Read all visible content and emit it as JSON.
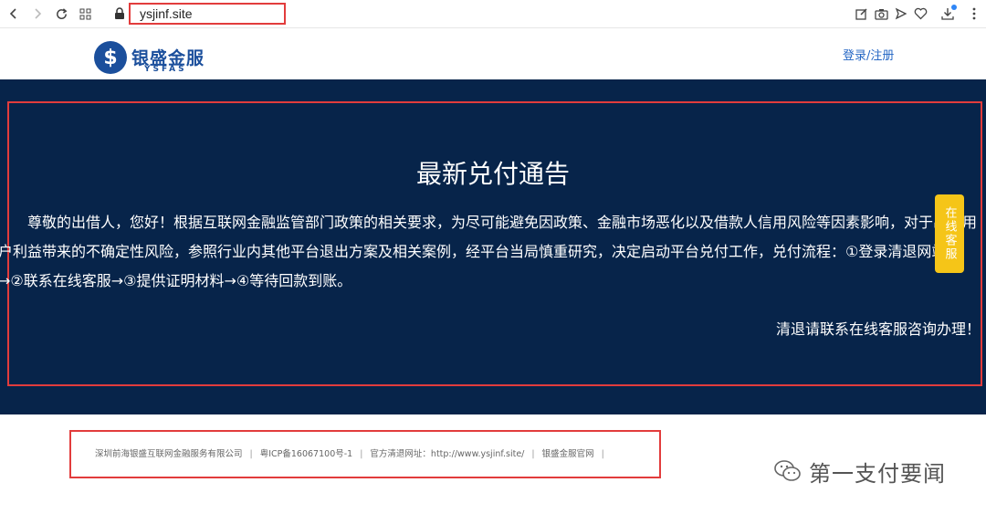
{
  "browser": {
    "url": "ysjinf.site"
  },
  "site": {
    "logo_cn": "银盛金服",
    "logo_en": "YSFAS",
    "login_label": "登录/注册"
  },
  "notice": {
    "title": "最新兑付通告",
    "lines": [
      "　　尊敬的出借人，您好！根据互联网金融监管部门政策的相关要求，为尽可能避免因政策、金融市场恶化以及借款人信用风险等因素影响，对于出借用",
      "户利益带来的不确定性风险，参照行业内其他平台退出方案及相关案例，经平台当局慎重研究，决定启动平台兑付工作，兑付流程：①登录清退网站",
      "→②联系在线客服→③提供证明材料→④等待回款到账。"
    ],
    "closing": "清退请联系在线客服咨询办理！",
    "cs_tab": "在线客服"
  },
  "footer": {
    "company": "深圳前海银盛互联网金融服务有限公司",
    "icp": "粤ICP备16067100号-1",
    "official": "官方清退网址：http://www.ysjinf.site/",
    "site_link": "银盛金服官网"
  },
  "watermark": {
    "text": "第一支付要闻"
  },
  "colors": {
    "banner_bg": "#07244a",
    "brand_blue": "#1b4f9c",
    "highlight_red": "#e23c3c",
    "cs_yellow": "#f5c518"
  }
}
